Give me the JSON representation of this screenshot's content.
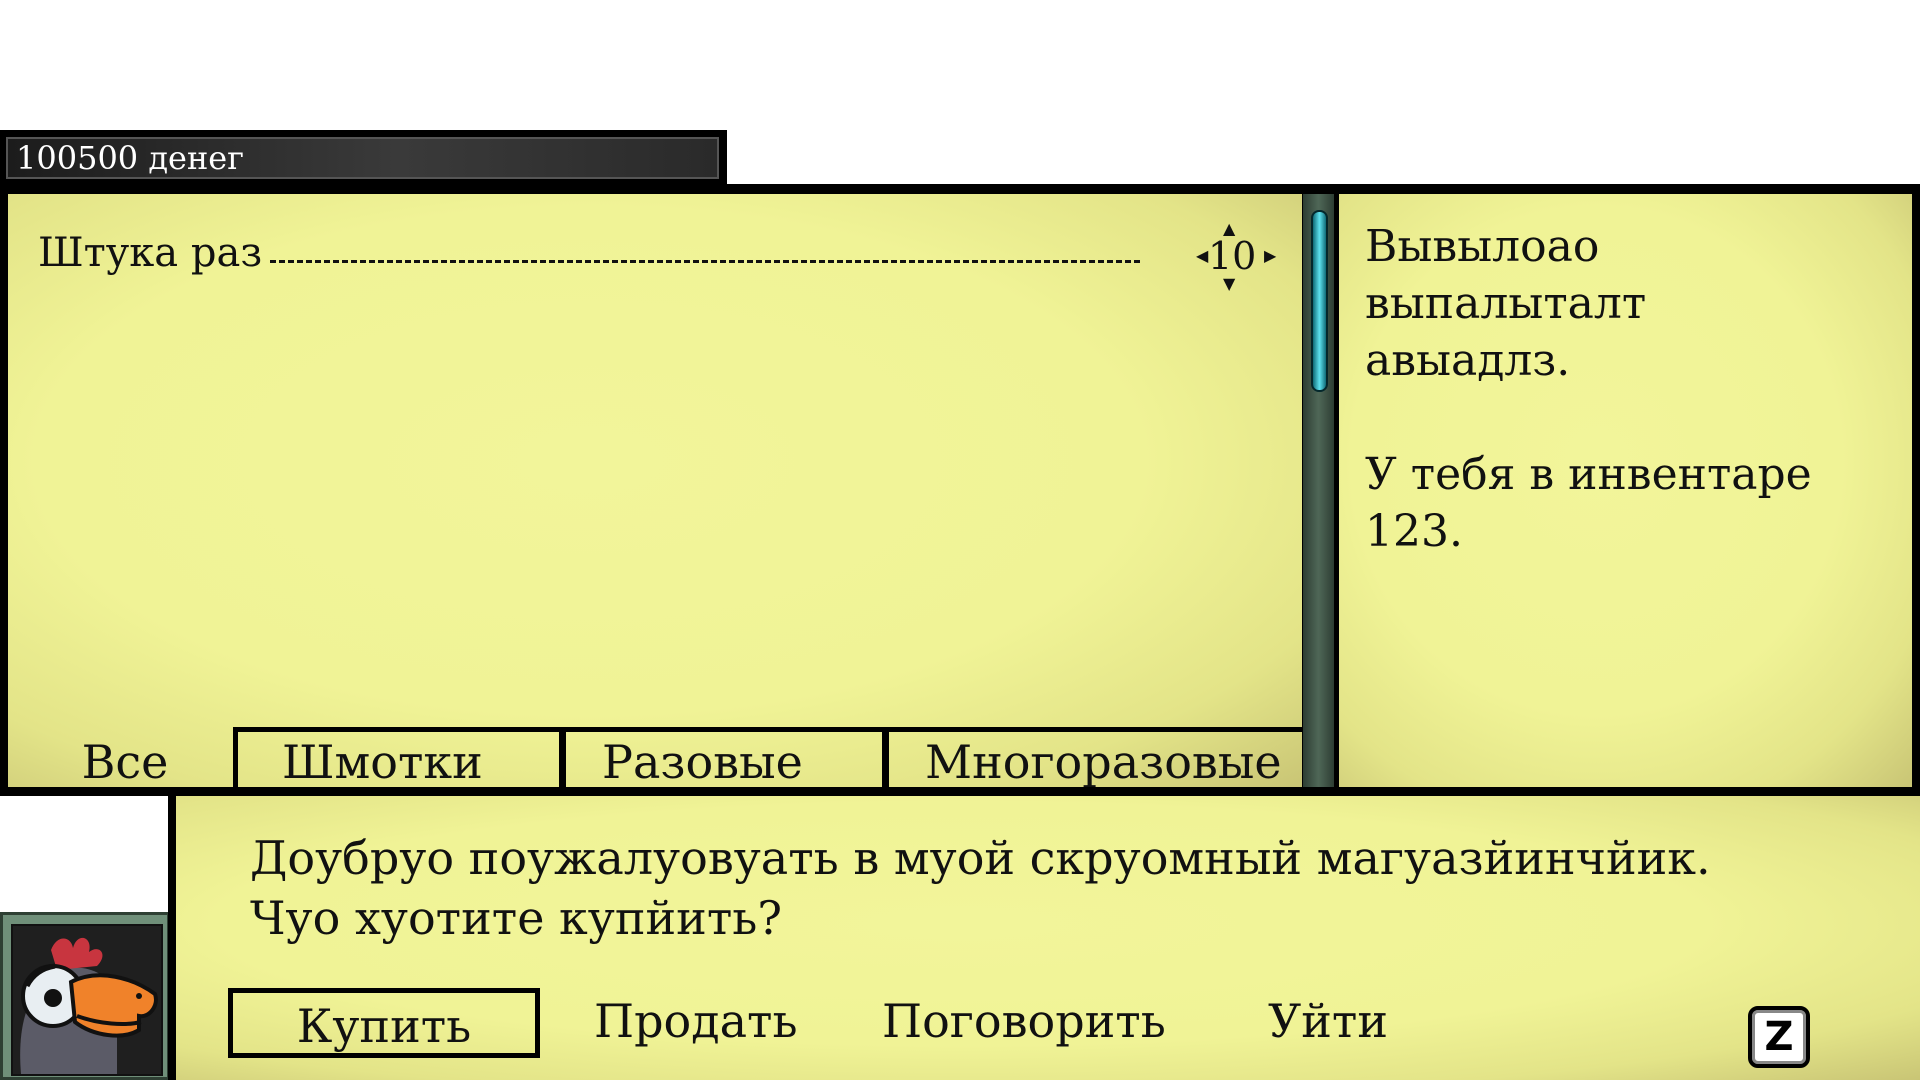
{
  "money": {
    "label": "100500 денег"
  },
  "items": [
    {
      "name": "Штука раз",
      "quantity": "10"
    }
  ],
  "tabs": [
    {
      "label": "Все",
      "selected": true
    },
    {
      "label": "Шмотки",
      "selected": false
    },
    {
      "label": "Разовые",
      "selected": false
    },
    {
      "label": "Многоразовые",
      "selected": false
    }
  ],
  "description": {
    "lines": [
      "Вывылоао",
      "выпалыталт",
      "авыадлз."
    ],
    "inventory": "У тебя в инвентаре 123."
  },
  "dialog": {
    "lines": [
      "Доубруо поужалуовуать в муой скруомный магуазйинчйик.",
      "Чуо хуотите купйить?"
    ]
  },
  "options": [
    {
      "label": "Купить",
      "selected": true
    },
    {
      "label": "Продать",
      "selected": false
    },
    {
      "label": "Поговорить",
      "selected": false
    },
    {
      "label": "Уйти",
      "selected": false
    }
  ],
  "confirm_key": "Z",
  "colors": {
    "panel": "#f0f396",
    "frame": "#000000",
    "scroll_thumb": "#5fe3ef"
  }
}
